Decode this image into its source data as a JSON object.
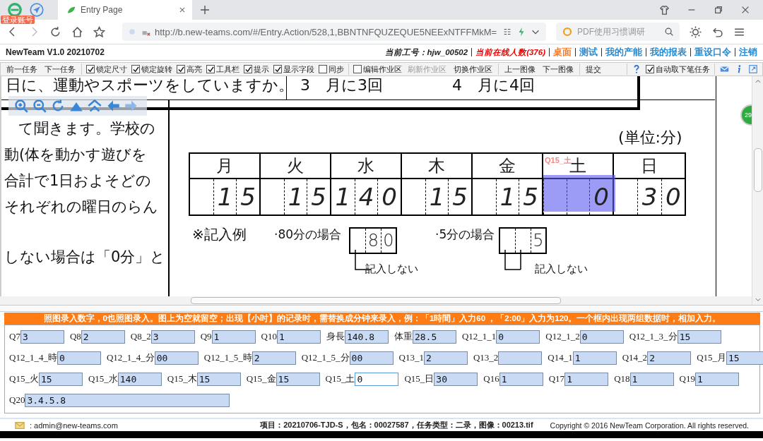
{
  "browser": {
    "account_badge": "登录账号",
    "tabs": [
      {
        "title": "Entry Page",
        "selected": true
      }
    ],
    "url": "http://b.new-teams.com/#/Entry.Action/528,1,BBNTNFQUZEQUE5NEExNTFFMkM=",
    "search": {
      "placeholder": "PDF使用习惯调研"
    }
  },
  "app_header": {
    "title": "NewTeam V1.0 20210702",
    "worker": "当前工号：hjw_00502",
    "online": "当前在线人数(376)",
    "links": [
      {
        "label": "桌面",
        "selected": true
      },
      {
        "label": "测试",
        "selected": false
      },
      {
        "label": "我的产能",
        "selected": false
      },
      {
        "label": "我的报表",
        "selected": false
      },
      {
        "label": "重设口令",
        "selected": false
      },
      {
        "label": "注销",
        "selected": false
      }
    ]
  },
  "toolbar": {
    "items": [
      {
        "kind": "button",
        "label": "前一任务",
        "disabled": false
      },
      {
        "kind": "button",
        "label": "下一任务",
        "disabled": false
      },
      {
        "kind": "separator"
      },
      {
        "kind": "checkbox",
        "label": "锁定尺寸",
        "checked": true
      },
      {
        "kind": "checkbox",
        "label": "锁定旋转",
        "checked": true
      },
      {
        "kind": "checkbox",
        "label": "高亮",
        "checked": true
      },
      {
        "kind": "checkbox",
        "label": "工具栏",
        "checked": true
      },
      {
        "kind": "checkbox",
        "label": "提示",
        "checked": true
      },
      {
        "kind": "checkbox",
        "label": "显示字段",
        "checked": true
      },
      {
        "kind": "checkbox",
        "label": "同步",
        "checked": false
      },
      {
        "kind": "separator"
      },
      {
        "kind": "checkbox",
        "label": "编辑作业区",
        "checked": false
      },
      {
        "kind": "button",
        "label": "刷新作业区",
        "disabled": true
      },
      {
        "kind": "button",
        "label": "切换作业区",
        "disabled": false
      },
      {
        "kind": "separator"
      },
      {
        "kind": "button",
        "label": "上一图像",
        "disabled": false
      },
      {
        "kind": "button",
        "label": "下一图像",
        "disabled": false
      },
      {
        "kind": "separator"
      },
      {
        "kind": "button",
        "label": "提交",
        "disabled": false
      }
    ],
    "auto_next_task": {
      "label": "自动取下笔任务",
      "checked": true
    }
  },
  "document": {
    "question_text": "日に、運動やスポーツをしていますか。",
    "choices": [
      "3　月に3回",
      "4　月に4回"
    ],
    "passage_lines": [
      "て聞きます。学校の",
      "動(体を動かす遊びを",
      "合計で1日およそどの",
      "それぞれの曜日のらん",
      "しない場合は「0分」と"
    ],
    "unit": "(単位:分)",
    "days": [
      {
        "day": "月",
        "digits": [
          "1",
          "5"
        ],
        "highlighted": false
      },
      {
        "day": "火",
        "digits": [
          "1",
          "5"
        ],
        "highlighted": false
      },
      {
        "day": "水",
        "digits": [
          "1",
          "4",
          "0"
        ],
        "highlighted": false
      },
      {
        "day": "木",
        "digits": [
          "1",
          "5"
        ],
        "highlighted": false
      },
      {
        "day": "金",
        "digits": [
          "1",
          "5"
        ],
        "highlighted": false
      },
      {
        "day": "土",
        "digits": [
          "0"
        ],
        "highlighted": true,
        "field_label": "Q15_土"
      },
      {
        "day": "日",
        "digits": [
          "3",
          "0"
        ],
        "highlighted": false
      }
    ],
    "example": {
      "title": "※記入例",
      "cases": [
        {
          "label": "·80分の場合",
          "digits": [
            "8",
            "0"
          ],
          "note": "記入しない"
        },
        {
          "label": "·5分の場合",
          "digits": [
            "5"
          ],
          "note": "記入しない"
        }
      ]
    }
  },
  "side_badge": "29",
  "instruction": "照图录入数字，0也照图录入。图上为空就留空；出现【小时】的记录时，需替换成分钟来录入，例：「1時間」入力60 ，「2:00」入力为120。一个框内出现两组数据时，相加入力。",
  "form_rows": [
    [
      {
        "label": "Q7",
        "value": "3",
        "focused": false
      },
      {
        "label": "Q8",
        "value": "2",
        "focused": false
      },
      {
        "label": "Q8_2",
        "value": "3",
        "focused": false
      },
      {
        "label": "Q9",
        "value": "1",
        "focused": false
      },
      {
        "label": "Q10",
        "value": "1",
        "focused": false
      },
      {
        "label": "身長",
        "value": "140.8",
        "focused": false
      },
      {
        "label": "体重",
        "value": "28.5",
        "focused": false
      },
      {
        "label": "Q12_1_1",
        "value": "0",
        "focused": false
      },
      {
        "label": "Q12_1_2",
        "value": "0",
        "focused": false
      },
      {
        "label": "Q12_1_3_分",
        "value": "15",
        "focused": false
      }
    ],
    [
      {
        "label": "Q12_1_4_時",
        "value": "0",
        "focused": false
      },
      {
        "label": "Q12_1_4_分",
        "value": "00",
        "focused": false
      },
      {
        "label": "Q12_1_5_時",
        "value": "2",
        "focused": false
      },
      {
        "label": "Q12_1_5_分",
        "value": "00",
        "focused": false
      },
      {
        "label": "Q13_1",
        "value": "2",
        "focused": false
      },
      {
        "label": "Q13_2",
        "focused": false
      },
      {
        "label": "Q14_1",
        "value": "1",
        "focused": false
      },
      {
        "label": "Q14_2",
        "value": "2",
        "focused": false
      },
      {
        "label": "Q15_月",
        "value": "15",
        "focused": false
      }
    ],
    [
      {
        "label": "Q15_火",
        "value": "15",
        "focused": false
      },
      {
        "label": "Q15_水",
        "value": "140",
        "focused": false
      },
      {
        "label": "Q15_木",
        "value": "15",
        "focused": false
      },
      {
        "label": "Q15_金",
        "value": "15",
        "focused": false
      },
      {
        "label": "Q15_土",
        "value": "0",
        "focused": true
      },
      {
        "label": "Q15_日",
        "value": "30",
        "focused": false
      },
      {
        "label": "Q16",
        "value": "1",
        "focused": false
      },
      {
        "label": "Q17",
        "value": "1",
        "focused": false
      },
      {
        "label": "Q18",
        "value": "1",
        "focused": false
      },
      {
        "label": "Q19",
        "value": "1",
        "focused": false
      }
    ],
    [
      {
        "label": "Q20",
        "value": "3.4.5.8",
        "focused": false,
        "kind": "wide"
      }
    ]
  ],
  "status_bar": {
    "email": ": admin@new-teams.com",
    "task_info": "项目：20210706-TJD-S，包名：00027587，任务类型：二录，图像：00213.tif",
    "copyright": "Copyright © 2016 NewTeam Corporation. All rights reserved."
  }
}
